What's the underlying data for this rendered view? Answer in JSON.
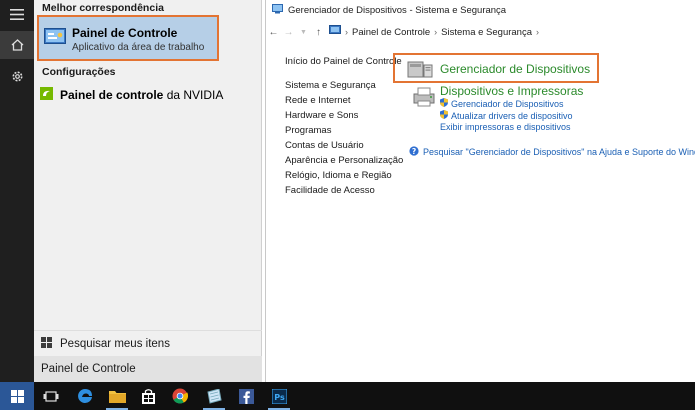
{
  "rail": {
    "icons": [
      "hamburger-icon",
      "home-icon",
      "settings-icon"
    ]
  },
  "search": {
    "best_header": "Melhor correspondência",
    "best_title": "Painel de Controle",
    "best_subtitle": "Aplicativo da área de trabalho",
    "settings_header": "Configurações",
    "nvidia_bold": "Painel de controle",
    "nvidia_rest": "da NVIDIA",
    "search_mine": "Pesquisar meus itens",
    "query": "Painel de Controle"
  },
  "window": {
    "title": "Gerenciador de Dispositivos - Sistema e Segurança",
    "breadcrumb": [
      "Painel de Controle",
      "Sistema e Segurança"
    ],
    "left_nav_home": "Início do Painel de Controle",
    "left_nav": [
      "Sistema e Segurança",
      "Rede e Internet",
      "Hardware e Sons",
      "Programas",
      "Contas de Usuário",
      "Aparência e Personalização",
      "Relógio, Idioma e Região",
      "Facilidade de Acesso"
    ],
    "main_result": "Gerenciador de Dispositivos",
    "devices_title": "Dispositivos e Impressoras",
    "devices_links": [
      "Gerenciador de Dispositivos",
      "Atualizar drivers de dispositivo",
      "Exibir impressoras e dispositivos"
    ],
    "help_text": "Pesquisar \"Gerenciador de Dispositivos\" na Ajuda e Suporte do Windows"
  },
  "taskbar": {
    "items": [
      "windows-start-icon",
      "task-view-icon",
      "edge-icon",
      "file-explorer-icon",
      "store-icon",
      "chrome-icon",
      "notepad-icon",
      "facebook-icon",
      "photoshop-icon"
    ]
  },
  "colors": {
    "highlight_border": "#e37433",
    "selected_bg": "#b6cfe7",
    "link_green": "#2b8a2b",
    "link_blue": "#1a5fb4"
  }
}
